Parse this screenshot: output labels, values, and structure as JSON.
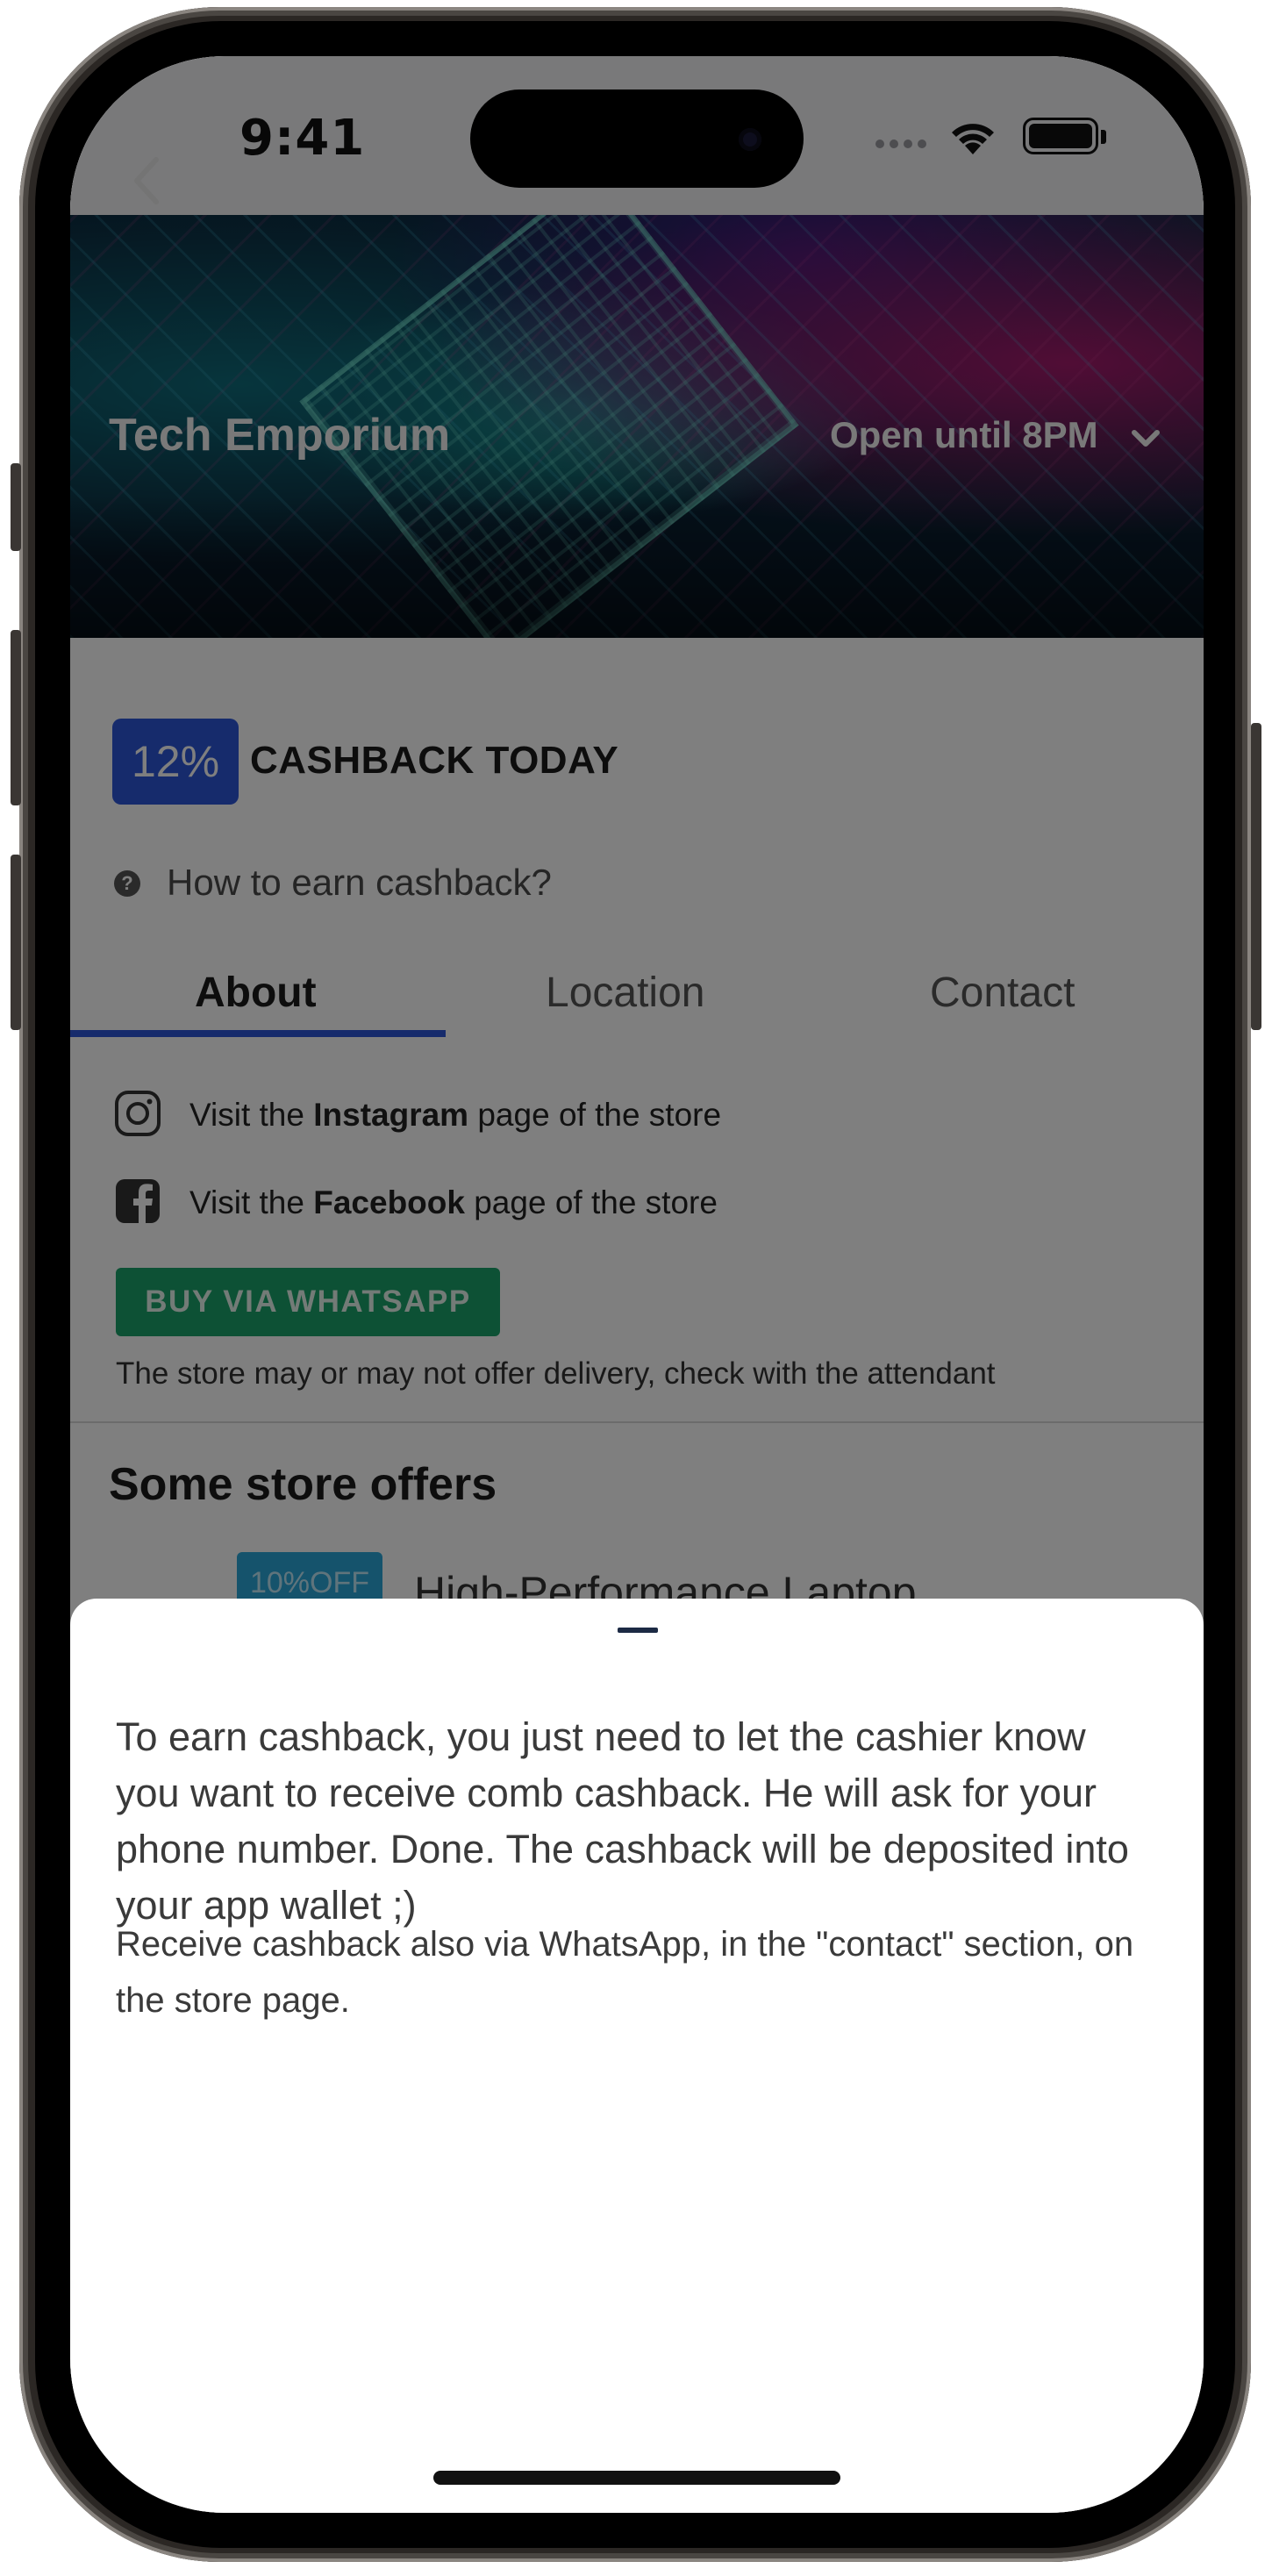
{
  "status_bar": {
    "time": "9:41"
  },
  "store": {
    "name": "Tech Emporium",
    "hours": "Open until 8PM"
  },
  "cashback": {
    "percent": "12%",
    "label": "CASHBACK TODAY",
    "help_link": "How to earn cashback?"
  },
  "tabs": [
    {
      "label": "About",
      "active": true
    },
    {
      "label": "Location",
      "active": false
    },
    {
      "label": "Contact",
      "active": false
    }
  ],
  "about": {
    "instagram": {
      "prefix": "Visit the ",
      "bold": "Instagram",
      "suffix": " page of the store"
    },
    "facebook": {
      "prefix": "Visit the ",
      "bold": "Facebook",
      "suffix": " page of the store"
    },
    "whatsapp_button": "BUY VIA WHATSAPP",
    "delivery_note": "The store may or may not offer delivery, check with the attendant"
  },
  "offers": {
    "title": "Some store offers",
    "items": [
      {
        "badge": "10%OFF",
        "title": "High-Performance Laptop"
      }
    ]
  },
  "sheet": {
    "main_text": "To earn cashback, you just need to let the cashier know you want to receive comb cashback. He will ask for your phone number. Done. The cashback will be deposited into your app wallet ;)",
    "sub_text": "Receive cashback also via WhatsApp, in the \"contact\" section, on the store page."
  },
  "colors": {
    "accent_blue": "#2c56d9",
    "whatsapp_green": "#1aa36a",
    "offer_badge": "#2aa7d8"
  }
}
